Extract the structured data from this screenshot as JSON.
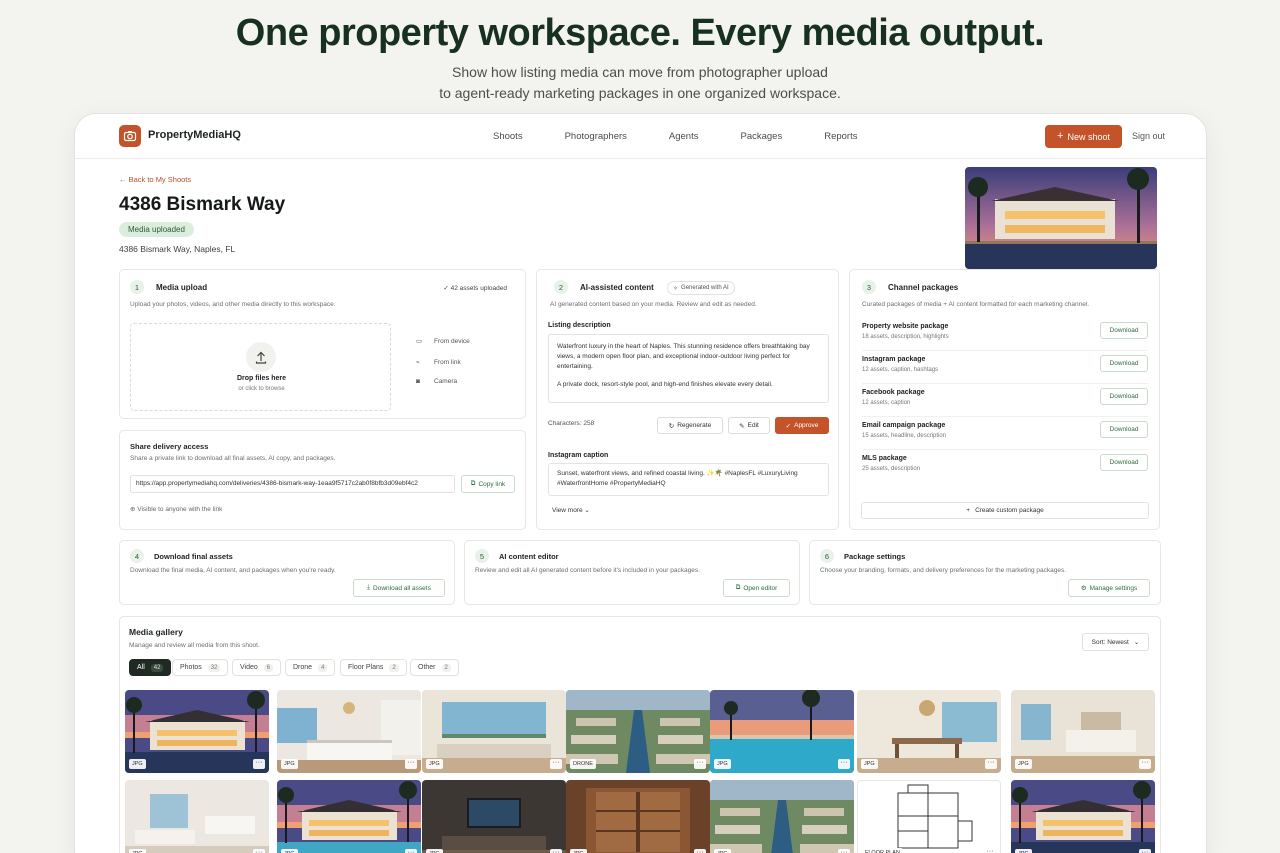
{
  "hero": {
    "title": "One property workspace. Every media output.",
    "subtitle_line1": "Show how listing media can move from photographer upload",
    "subtitle_line2": "to agent-ready marketing packages in one organized workspace."
  },
  "app": {
    "brand": "PropertyMediaHQ",
    "nav": [
      "Shoots",
      "Photographers",
      "Agents",
      "Packages",
      "Reports"
    ],
    "new_shoot": "New shoot",
    "sign_out": "Sign out"
  },
  "property": {
    "back": "Back to My Shoots",
    "title": "4386 Bismark Way",
    "status": "Media uploaded",
    "address": "4386 Bismark Way, Naples, FL"
  },
  "upload": {
    "num": "1",
    "title": "Media upload",
    "status": "42 assets uploaded",
    "desc": "Upload your photos, videos, and other media directly to this workspace.",
    "drop_title": "Drop files here",
    "drop_sub": "or click to browse",
    "sources": [
      "From device",
      "From link",
      "Camera"
    ]
  },
  "share": {
    "title": "Share delivery access",
    "desc": "Share a private link to download all final assets, AI copy, and packages.",
    "link": "https://app.propertymediahq.com/deliveries/4386-bismark-way-1eaa9f5717c2ab0f8bfb3d09ebf4c2",
    "copy": "Copy link",
    "visibility": "Visible to anyone with the link"
  },
  "ai": {
    "num": "2",
    "title": "AI-assisted content",
    "generated": "Generated with AI",
    "desc": "AI generated content based on your media. Review and edit as needed.",
    "listing_label": "Listing description",
    "listing_p1": "Waterfront luxury in the heart of Naples. This stunning residence offers breathtaking bay views, a modern open floor plan, and exceptional indoor-outdoor living perfect for entertaining.",
    "listing_p2": "A private dock, resort-style pool, and high-end finishes elevate every detail.",
    "characters": "Characters: 258",
    "regenerate": "Regenerate",
    "edit": "Edit",
    "approve": "Approve",
    "caption_label": "Instagram caption",
    "caption": "Sunset, waterfront views, and refined coastal living. ✨🌴 #NaplesFL #LuxuryLiving #WaterfrontHome #PropertyMediaHQ",
    "view_more": "View more"
  },
  "channels": {
    "num": "3",
    "title": "Channel packages",
    "desc": "Curated packages of media + AI content formatted for each marketing channel.",
    "download": "Download",
    "packages": [
      {
        "name": "Property website package",
        "meta": "18 assets, description, highlights"
      },
      {
        "name": "Instagram package",
        "meta": "12 assets, caption, hashtags"
      },
      {
        "name": "Facebook package",
        "meta": "12 assets, caption"
      },
      {
        "name": "Email campaign package",
        "meta": "15 assets, headline, description"
      },
      {
        "name": "MLS package",
        "meta": "25 assets, description"
      }
    ],
    "custom": "Create custom package"
  },
  "download_final": {
    "num": "4",
    "title": "Download final assets",
    "desc": "Download the final media, AI content, and packages when you're ready.",
    "button": "Download all assets"
  },
  "editor": {
    "num": "5",
    "title": "AI content editor",
    "desc": "Review and edit all AI generated content before it's included in your packages.",
    "button": "Open editor"
  },
  "settings": {
    "num": "6",
    "title": "Package settings",
    "desc": "Choose your branding, formats, and delivery preferences for the marketing packages.",
    "button": "Manage settings"
  },
  "gallery": {
    "title": "Media gallery",
    "desc": "Manage and review all media from this shoot.",
    "sort": "Sort: Newest",
    "filters": [
      {
        "label": "All",
        "count": "42"
      },
      {
        "label": "Photos",
        "count": "32"
      },
      {
        "label": "Video",
        "count": "6"
      },
      {
        "label": "Drone",
        "count": "4"
      },
      {
        "label": "Floor Plans",
        "count": "2"
      },
      {
        "label": "Other",
        "count": "2"
      }
    ],
    "tags_row1": [
      "JPG",
      "JPG",
      "JPG",
      "DRONE",
      "JPG",
      "JPG",
      "JPG"
    ],
    "tags_row2": [
      "JPG",
      "JPG",
      "JPG",
      "JPG",
      "JPG",
      "FLOOR PLAN",
      "JPG"
    ],
    "more": "···"
  }
}
